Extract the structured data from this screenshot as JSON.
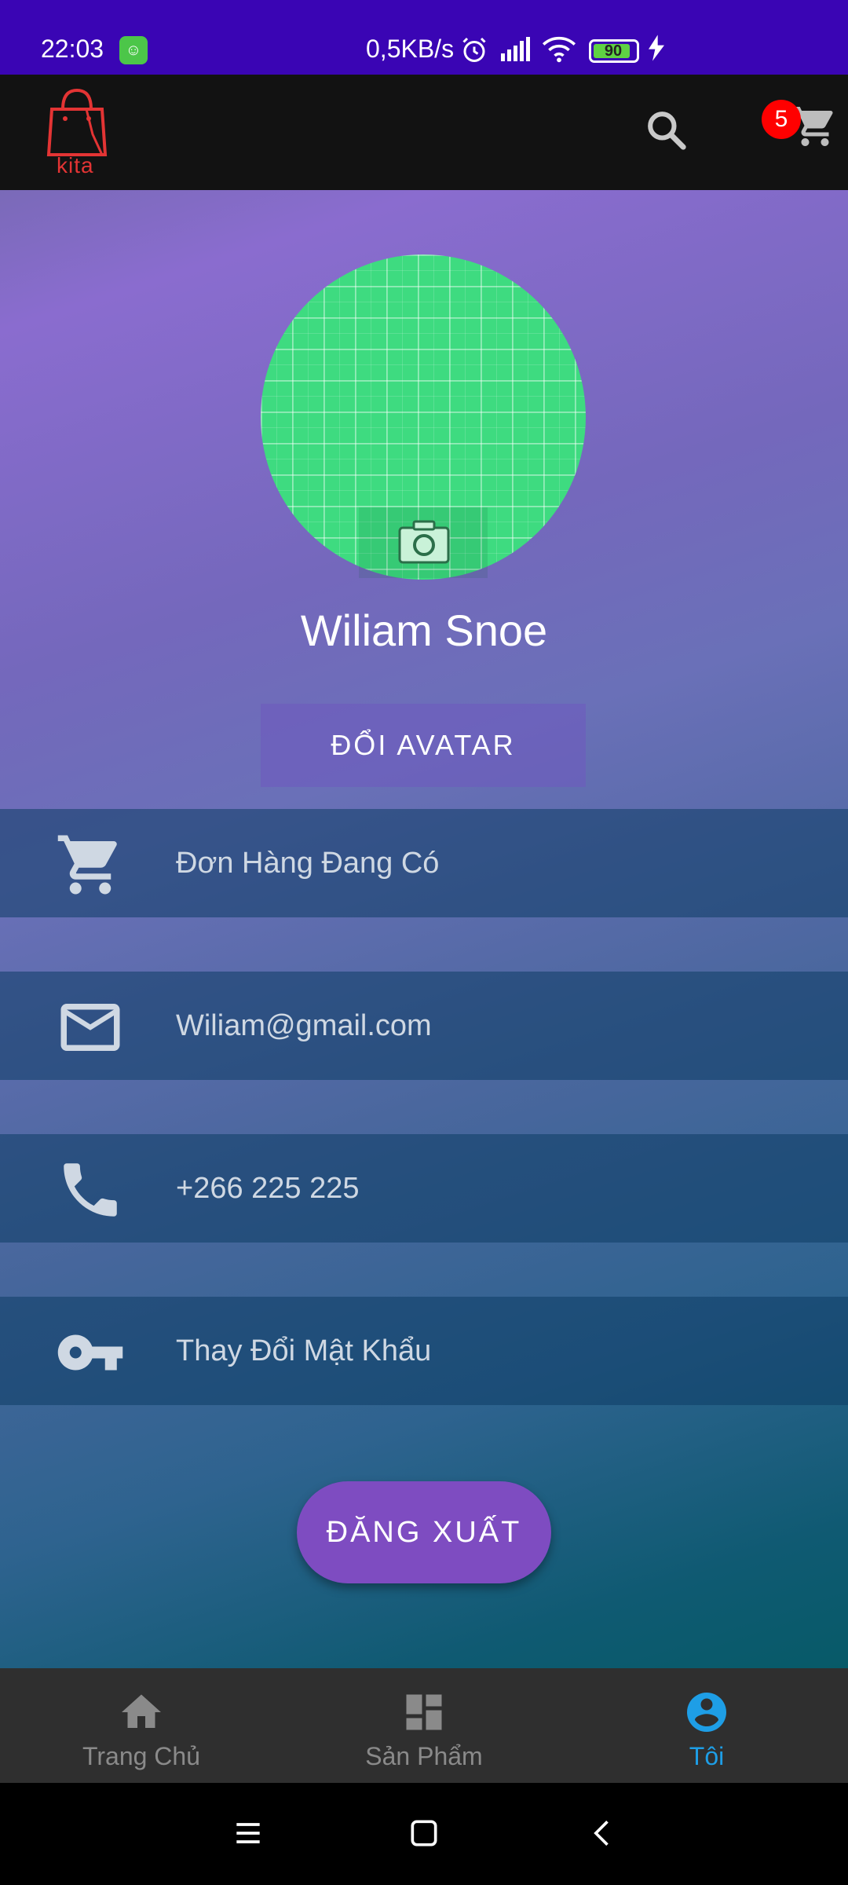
{
  "status_bar": {
    "time": "22:03",
    "network_speed": "0,5KB/s",
    "battery_level": "90"
  },
  "app_bar": {
    "logo_text": "kita",
    "cart_count": "5"
  },
  "profile": {
    "name": "Wiliam Snoe",
    "change_avatar_label": "ĐỔI AVATAR"
  },
  "info_rows": [
    {
      "icon": "cart-icon",
      "label": "Đơn Hàng Đang Có"
    },
    {
      "icon": "mail-icon",
      "label": "Wiliam@gmail.com"
    },
    {
      "icon": "phone-icon",
      "label": "+266 225 225"
    },
    {
      "icon": "key-icon",
      "label": "Thay Đổi Mật Khẩu"
    }
  ],
  "logout_label": "ĐĂNG XUẤT",
  "bottom_nav": [
    {
      "icon": "home-icon",
      "label": "Trang Chủ"
    },
    {
      "icon": "dashboard-icon",
      "label": "Sản Phẩm"
    },
    {
      "icon": "account-circle-icon",
      "label": "Tôi",
      "active": true
    }
  ],
  "colors": {
    "status_bar": "#3a05b4",
    "app_bar": "#121212",
    "accent": "#1e9ee6",
    "logout": "#7e4cc1",
    "badge": "#ff0000",
    "logo": "#e33434"
  }
}
